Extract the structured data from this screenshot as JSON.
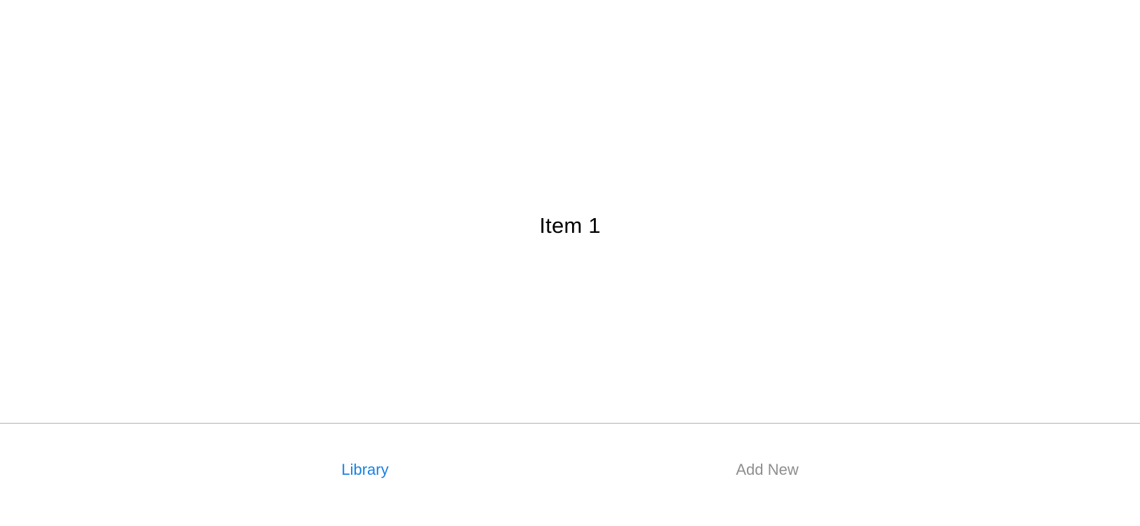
{
  "main": {
    "title": "Item 1"
  },
  "tabbar": {
    "tabs": [
      {
        "label": "Library",
        "selected": true
      },
      {
        "label": "Add New",
        "selected": false
      }
    ]
  },
  "colors": {
    "background": "#ffffff",
    "divider": "#b2b2b2",
    "tab_active": "#1a82e2",
    "tab_inactive": "#8e8e8e",
    "text_primary": "#000000"
  }
}
